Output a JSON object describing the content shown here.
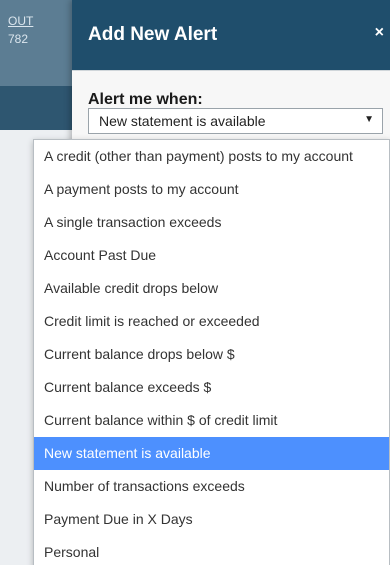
{
  "background": {
    "link_text": "OUT",
    "number_text": "782"
  },
  "modal": {
    "title": "Add New Alert",
    "close_label": "×",
    "alert_label": "Alert me when:",
    "select_value": "New statement is available",
    "select_arrow": "▼"
  },
  "dropdown": {
    "selected_index": 9,
    "options": [
      "A credit (other than payment) posts to my account",
      "A payment posts to my account",
      "A single transaction exceeds",
      "Account Past Due",
      "Available credit drops below",
      "Credit limit is reached or exceeded",
      "Current balance drops below $",
      "Current balance exceeds $",
      "Current balance within $ of credit limit",
      "New statement is available",
      "Number of transactions exceeds",
      "Payment Due in X Days",
      "Personal"
    ]
  },
  "colors": {
    "header_bg": "#1f4e6c",
    "selected_bg": "#4d90fe",
    "band": "#2e5670"
  }
}
